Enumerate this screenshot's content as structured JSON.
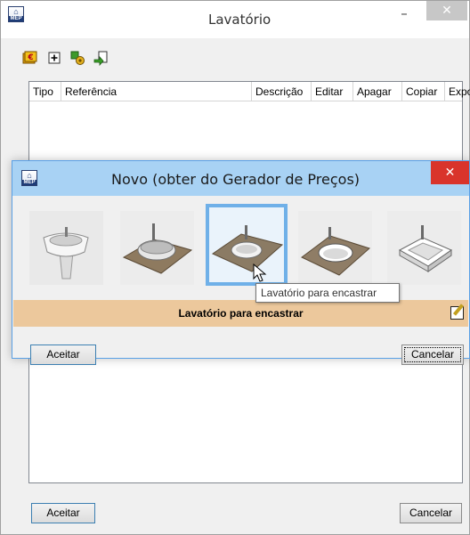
{
  "main_window": {
    "title": "Lavatório",
    "controls": {
      "minimize": "–",
      "close": "✕"
    },
    "toolbar": [
      {
        "name": "price-generator-icon",
        "glyph": "€"
      },
      {
        "name": "add-icon",
        "glyph": "+"
      },
      {
        "name": "import-icon",
        "glyph": "⚙"
      },
      {
        "name": "export-arrow-icon",
        "glyph": "➜"
      }
    ],
    "columns": [
      "Tipo",
      "Referência",
      "Descrição",
      "Editar",
      "Apagar",
      "Copiar",
      "Exportar"
    ],
    "rows": [],
    "accept_label": "Aceitar",
    "cancel_label": "Cancelar"
  },
  "dialog": {
    "title": "Novo (obter do Gerador de Preços)",
    "close": "✕",
    "thumbnails": [
      {
        "name": "pedestal-basin",
        "selected": false
      },
      {
        "name": "countertop-bowl-basin",
        "selected": false
      },
      {
        "name": "inset-basin",
        "selected": true
      },
      {
        "name": "undermount-basin",
        "selected": false
      },
      {
        "name": "square-basin",
        "selected": false
      }
    ],
    "tooltip": "Lavatório para encastrar",
    "description": "Lavatório para encastrar",
    "accept_label": "Aceitar",
    "cancel_label": "Cancelar"
  },
  "colors": {
    "dialog_title_bar": "#a8d2f4",
    "dialog_close": "#d9342b",
    "description_bar": "#ecc89c",
    "selection_border": "#6fb0e8"
  }
}
